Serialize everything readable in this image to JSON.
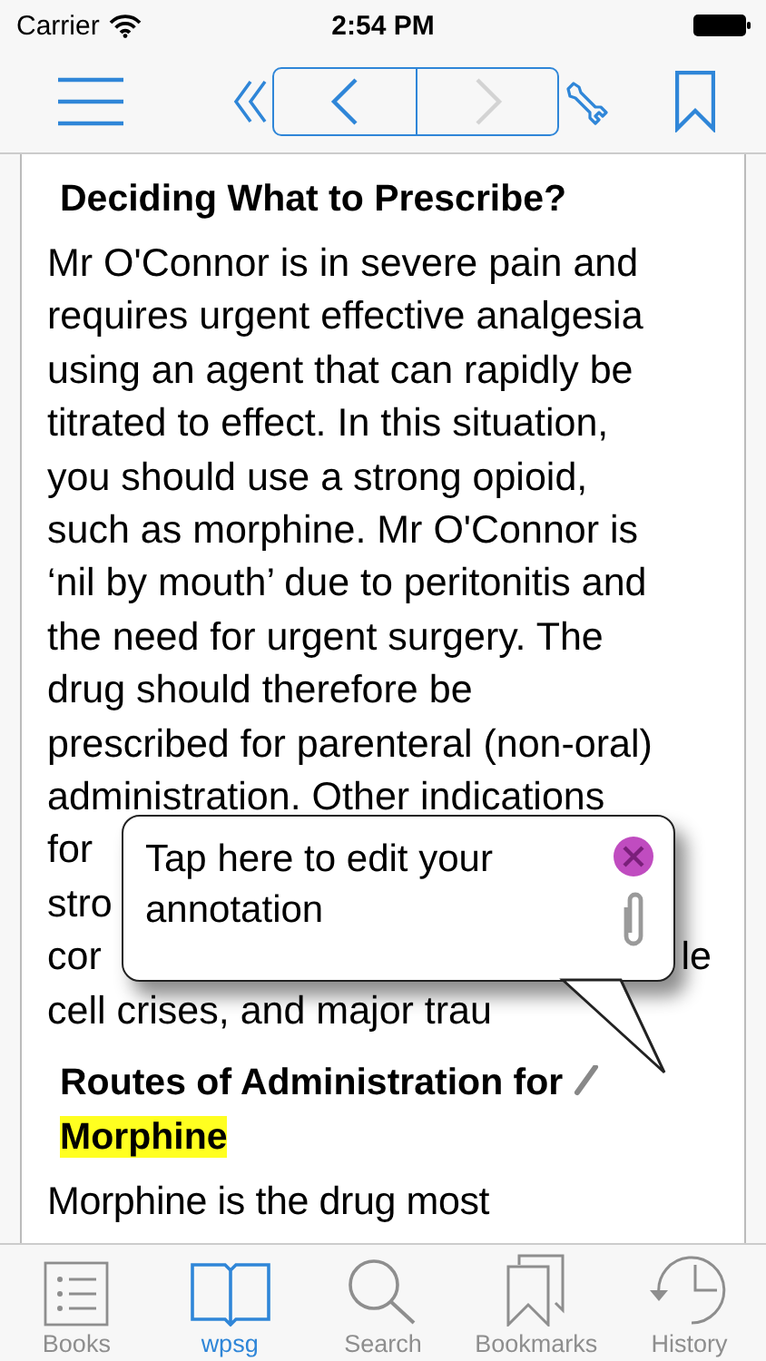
{
  "status_bar": {
    "carrier": "Carrier",
    "time": "2:54 PM"
  },
  "toolbar": {
    "back_enabled": true,
    "forward_enabled": false
  },
  "article": [
    {
      "kind": "heading",
      "parts": [
        {
          "text": "Deciding What to Prescribe?",
          "highlighted": false
        }
      ]
    },
    {
      "kind": "lines",
      "lines": [
        [
          "Mr O'Connor is in severe pain and"
        ],
        [
          "requires urgent effective analgesia"
        ],
        [
          "using an agent that can rapidly be"
        ],
        [
          "titrated to effect. In this situation,"
        ],
        [
          "you should use a strong opioid,"
        ],
        [
          "such as morphine. Mr O'Connor is"
        ],
        [
          "‘nil by mouth’ due to peritonitis and"
        ],
        [
          "the need for urgent surgery. The"
        ],
        [
          "drug should therefore be"
        ],
        [
          "prescribed for parenteral (non-oral)"
        ],
        [
          "administration. Other indications"
        ],
        [
          "for"
        ],
        [
          "stro"
        ],
        [
          "cor",
          "le"
        ],
        [
          "cell crises, and major trau"
        ]
      ]
    },
    {
      "kind": "heading",
      "annotated": true,
      "parts": [
        {
          "text": "Routes of Administration for",
          "highlighted": false
        },
        {
          "text": "Morphine",
          "highlighted": true
        }
      ]
    },
    {
      "kind": "paragraph",
      "text": "Morphine is the drug most"
    }
  ],
  "annotation": {
    "text": "Tap here to edit your annotation"
  },
  "tabs": [
    {
      "label": "Books",
      "selected": false
    },
    {
      "label": "wpsg",
      "selected": true
    },
    {
      "label": "Search",
      "selected": false
    },
    {
      "label": "Bookmarks",
      "selected": false
    },
    {
      "label": "History",
      "selected": false
    }
  ]
}
